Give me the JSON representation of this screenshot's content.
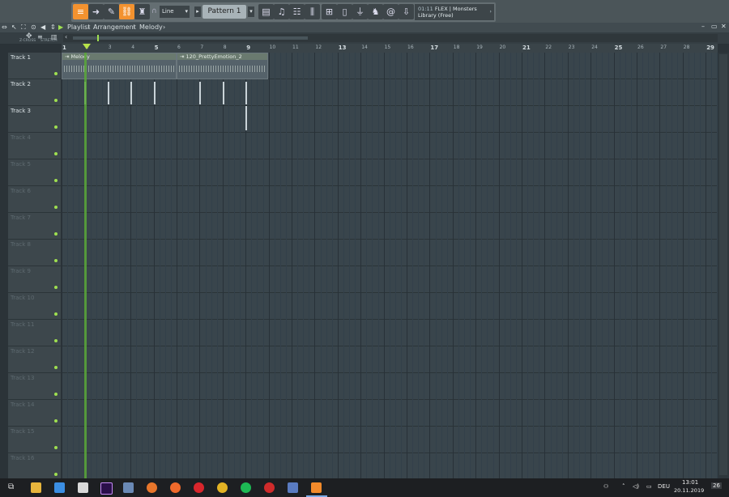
{
  "toolbar": {
    "snap_value": "Line",
    "pattern_name": "Pattern 1",
    "flex_time": "01:11",
    "flex_title": "FLEX | Monsters",
    "flex_sub": "Library (Free)"
  },
  "titlebar": {
    "crumbs": [
      "Playlist",
      "Arrangement",
      "Melody"
    ]
  },
  "subbar": {
    "zcross": "Z-CROSS",
    "stretch": "STRETCH"
  },
  "ruler": [
    "1",
    "2",
    "3",
    "4",
    "5",
    "6",
    "7",
    "8",
    "9",
    "10",
    "11",
    "12",
    "13",
    "14",
    "15",
    "16",
    "17",
    "18",
    "19",
    "20",
    "21",
    "22",
    "23",
    "24",
    "25",
    "26",
    "27",
    "28",
    "29"
  ],
  "tracks": [
    "Track 1",
    "Track 2",
    "Track 3",
    "Track 4",
    "Track 5",
    "Track 6",
    "Track 7",
    "Track 8",
    "Track 9",
    "Track 10",
    "Track 11",
    "Track 12",
    "Track 13",
    "Track 14",
    "Track 15",
    "Track 16"
  ],
  "clips": {
    "melody": "Melody",
    "pretty": "120_PrettyEmotion_2"
  },
  "taskbar": {
    "lang": "DEU",
    "time": "13:01",
    "date": "20.11.2019",
    "notif": "26"
  }
}
